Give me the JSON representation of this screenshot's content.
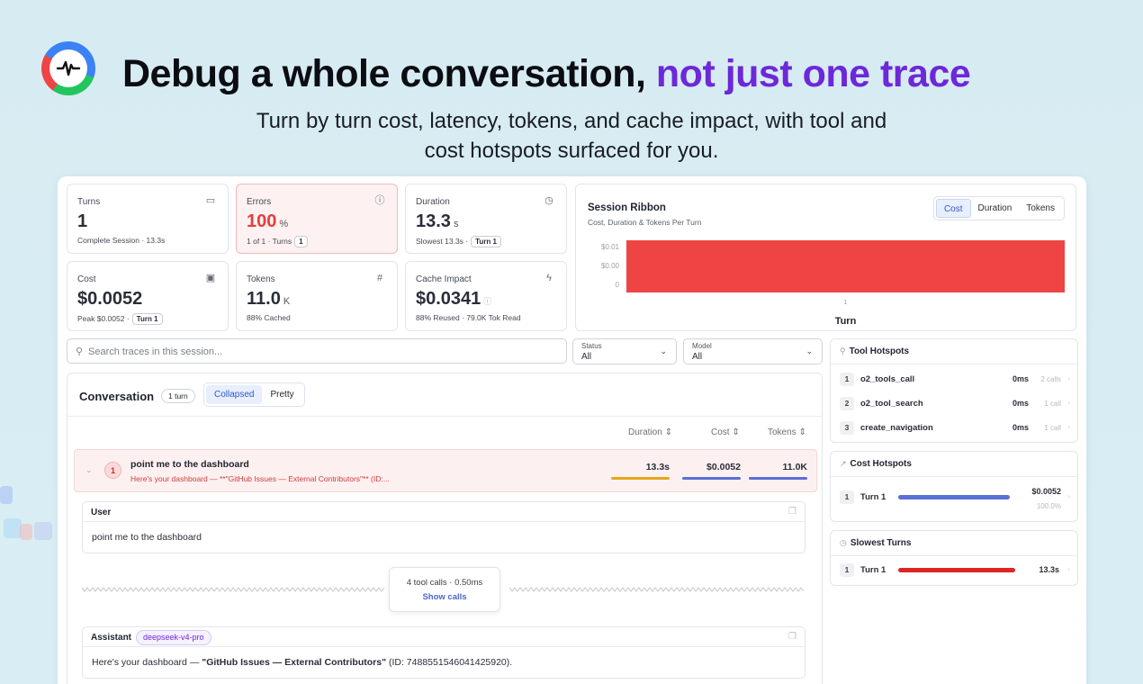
{
  "hero": {
    "title_main": "Debug a whole conversation, ",
    "title_accent": "not just one trace",
    "subtitle": "Turn by turn cost, latency, tokens, and cache impact, with tool and cost hotspots surfaced for you.",
    "accent_color": "#6d28d9"
  },
  "stats": {
    "turns": {
      "label": "Turns",
      "value": "1",
      "sub": "Complete Session · 13.3s",
      "icon": "chat-icon"
    },
    "errors": {
      "label": "Errors",
      "value": "100",
      "unit": "%",
      "sub": "1 of 1 · Turns",
      "pill": "1",
      "icon": "alert-icon"
    },
    "duration": {
      "label": "Duration",
      "value": "13.3",
      "unit": "s",
      "sub": "Slowest 13.3s ·",
      "pill": "Turn 1",
      "icon": "clock-icon"
    },
    "cost": {
      "label": "Cost",
      "value": "$0.0052",
      "sub": "Peak $0.0052 ·",
      "pill": "Turn 1",
      "icon": "money-icon"
    },
    "tokens": {
      "label": "Tokens",
      "value": "11.0",
      "unit": "K",
      "sub": "88% Cached",
      "icon": "hash-icon"
    },
    "cache": {
      "label": "Cache Impact",
      "value": "$0.0341",
      "sub": "88% Reused · 79.0K Tok Read",
      "icon": "bolt-icon"
    }
  },
  "ribbon": {
    "title": "Session Ribbon",
    "subtitle": "Cost, Duration & Tokens Per Turn",
    "tabs": [
      "Cost",
      "Duration",
      "Tokens"
    ],
    "active_tab": "Cost"
  },
  "chart_data": {
    "type": "bar",
    "categories": [
      "1"
    ],
    "values": [
      0.0052
    ],
    "xlabel": "Turn",
    "ylabel": "",
    "y_ticks": [
      "$0.01",
      "$0.00",
      "0"
    ],
    "bar_color": "#ef4444"
  },
  "search": {
    "placeholder": "Search traces in this session..."
  },
  "filters": {
    "status": {
      "label": "Status",
      "value": "All"
    },
    "model": {
      "label": "Model",
      "value": "All"
    }
  },
  "conversation": {
    "title": "Conversation",
    "badge": "1 turn",
    "view_tabs": [
      "Collapsed",
      "Pretty"
    ],
    "active_view": "Collapsed",
    "columns": [
      "Duration ⇕",
      "Cost ⇕",
      "Tokens ⇕"
    ],
    "turn": {
      "num": "1",
      "question": "point me to the dashboard",
      "answer_preview": "Here's your dashboard — **\"GitHub Issues — External Contributors\"** (ID:...",
      "duration": "13.3s",
      "cost": "$0.0052",
      "tokens": "11.0K"
    },
    "user_msg": {
      "label": "User",
      "text": "point me to the dashboard"
    },
    "tool_calls": {
      "summary": "4 tool calls · 0.50ms",
      "action": "Show calls"
    },
    "assistant_msg": {
      "label": "Assistant",
      "model": "deepseek-v4-pro",
      "text_pre": "Here's your dashboard — ",
      "text_bold": "\"GitHub Issues — External Contributors\"",
      "text_post": " (ID: 7488551546041425920)."
    }
  },
  "tool_hotspots": {
    "title": "Tool Hotspots",
    "items": [
      {
        "num": "1",
        "name": "o2_tools_call",
        "ms": "0ms",
        "calls": "2 calls"
      },
      {
        "num": "2",
        "name": "o2_tool_search",
        "ms": "0ms",
        "calls": "1 call"
      },
      {
        "num": "3",
        "name": "create_navigation",
        "ms": "0ms",
        "calls": "1 call"
      }
    ]
  },
  "cost_hotspots": {
    "title": "Cost Hotspots",
    "item": {
      "num": "1",
      "name": "Turn 1",
      "value": "$0.0052",
      "share": "100.0%",
      "fraction": 1.0
    }
  },
  "slowest_turns": {
    "title": "Slowest Turns",
    "item": {
      "num": "1",
      "name": "Turn 1",
      "value": "13.3s",
      "fraction": 1.0
    }
  }
}
